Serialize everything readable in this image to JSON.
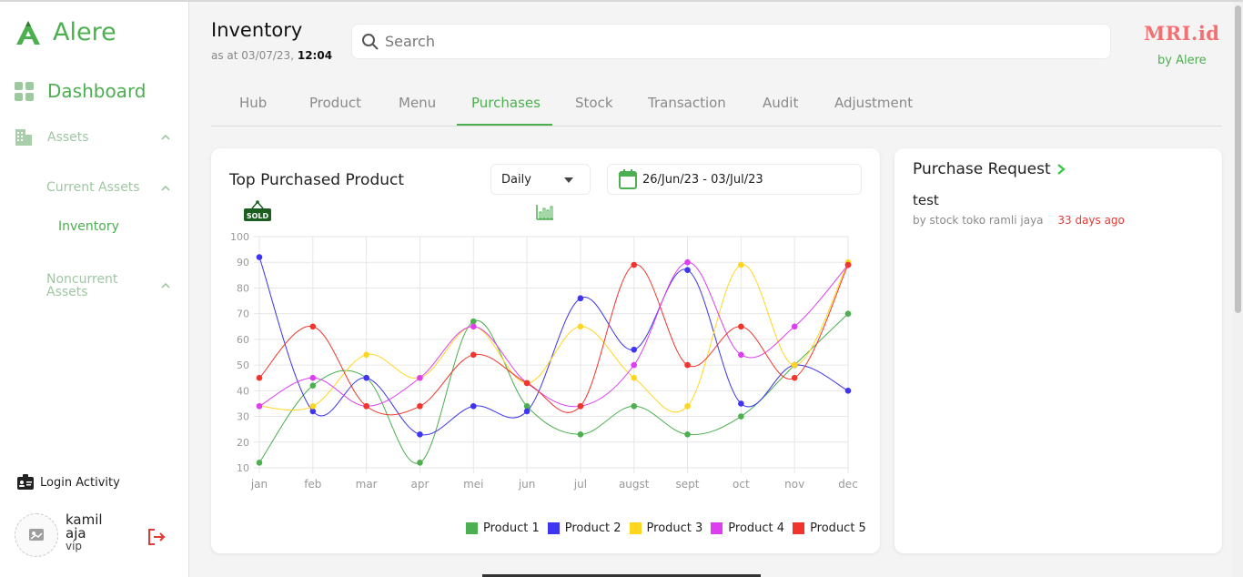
{
  "app": {
    "name": "Alere"
  },
  "sidebar": {
    "dashboard": "Dashboard",
    "assets": "Assets",
    "current_assets": "Current Assets",
    "inventory": "Inventory",
    "noncurrent_assets": "Noncurrent Assets",
    "login_activity": "Login Activity"
  },
  "user": {
    "name": "kamil aja",
    "role": "vip"
  },
  "header": {
    "title": "Inventory",
    "as_at_prefix": "as at 03/07/23,",
    "as_at_time": "12:04",
    "search_placeholder": "Search",
    "brand": "MRI.id",
    "brand_sub": "by Alere"
  },
  "tabs": [
    {
      "label": "Hub"
    },
    {
      "label": "Product"
    },
    {
      "label": "Menu"
    },
    {
      "label": "Purchases",
      "active": true
    },
    {
      "label": "Stock"
    },
    {
      "label": "Transaction"
    },
    {
      "label": "Audit"
    },
    {
      "label": "Adjustment"
    }
  ],
  "chart_card": {
    "title": "Top Purchased Product",
    "period": "Daily",
    "date_range": "26/Jun/23 - 03/Jul/23",
    "sold_badge": "SOLD"
  },
  "chart_data": {
    "type": "line",
    "categories": [
      "jan",
      "feb",
      "mar",
      "apr",
      "mei",
      "jun",
      "jul",
      "augst",
      "sept",
      "oct",
      "nov",
      "dec"
    ],
    "ylim": [
      10,
      100
    ],
    "yticks": [
      10,
      20,
      30,
      40,
      50,
      60,
      70,
      80,
      90,
      100
    ],
    "grid": true,
    "legend_position": "bottom",
    "series": [
      {
        "name": "Product 1",
        "color": "#4caf50",
        "values": [
          12,
          42,
          45,
          12,
          67,
          34,
          23,
          34,
          23,
          30,
          50,
          70
        ]
      },
      {
        "name": "Product 2",
        "color": "#3f35f0",
        "values": [
          92,
          32,
          45,
          23,
          34,
          32,
          76,
          56,
          87,
          35,
          50,
          40
        ]
      },
      {
        "name": "Product 3",
        "color": "#ffd61f",
        "values": [
          34,
          34,
          54,
          45,
          65,
          43,
          65,
          45,
          34,
          89,
          50,
          90
        ]
      },
      {
        "name": "Product 4",
        "color": "#dd3ff0",
        "values": [
          34,
          45,
          34,
          45,
          65,
          43,
          34,
          50,
          90,
          54,
          65,
          89
        ]
      },
      {
        "name": "Product 5",
        "color": "#f2352c",
        "values": [
          45,
          65,
          34,
          34,
          54,
          43,
          34,
          89,
          50,
          65,
          45,
          89
        ]
      }
    ]
  },
  "purchase_request": {
    "title": "Purchase Request",
    "items": [
      {
        "name": "test",
        "by": "by stock toko ramli jaya",
        "ago": "33 days ago"
      }
    ]
  },
  "colors": {
    "accent": "#4caf50",
    "brand": "#f26f72",
    "danger": "#e53935"
  }
}
